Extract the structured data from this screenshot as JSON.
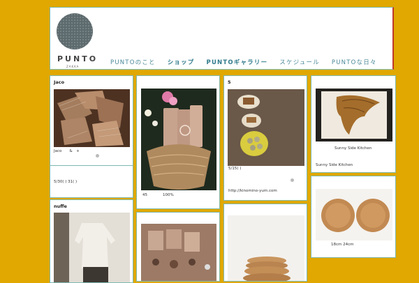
{
  "header": {
    "logo_text": "PUNTO",
    "logo_sub": "ZAKKA",
    "nav": [
      "PUNTOのこと",
      "ショップ",
      "PUNTOギャラリー",
      "スケジュール",
      "PUNTOな日々"
    ]
  },
  "cards": {
    "jaco": {
      "title": "Jaco",
      "caption": "Jaco　　&　+",
      "date": "5/30( ) 31( )"
    },
    "basket": {
      "caption": "45　　　　100%"
    },
    "five": {
      "title": "5",
      "date": "5/15( )",
      "url": "http://kinomino-yum.com"
    },
    "sunny": {
      "caption": "Sunny Side Kitchen",
      "label": "Sunny Side Kitchen"
    },
    "nuffe": {
      "title": "nuffe"
    },
    "plates": {
      "caption": "18cm 24cm"
    }
  }
}
